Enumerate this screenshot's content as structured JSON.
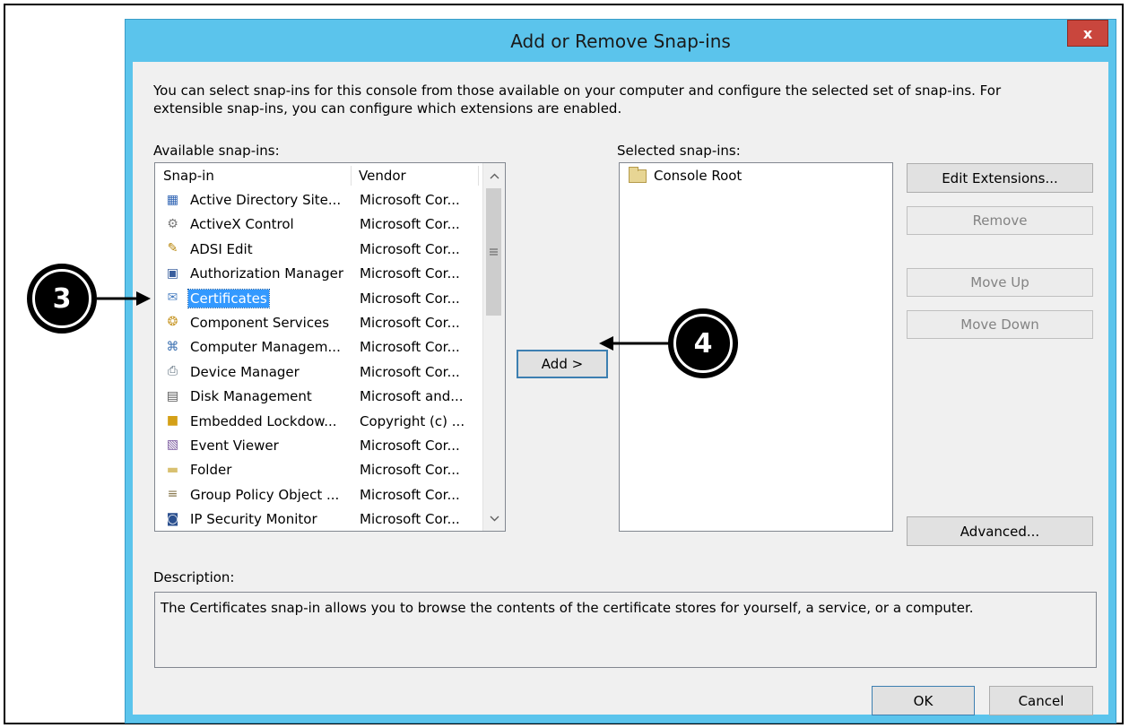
{
  "window": {
    "title": "Add or Remove Snap-ins",
    "close_label": "x"
  },
  "intro_text": "You can select snap-ins for this console from those available on your computer and configure the selected set of snap-ins. For extensible snap-ins, you can configure which extensions are enabled.",
  "available": {
    "label": "Available snap-ins:",
    "columns": [
      "Snap-in",
      "Vendor"
    ],
    "items": [
      {
        "name": "Active Directory Site...",
        "vendor": "Microsoft Cor...",
        "icon": "ad-sites-icon"
      },
      {
        "name": "ActiveX Control",
        "vendor": "Microsoft Cor...",
        "icon": "activex-icon"
      },
      {
        "name": "ADSI Edit",
        "vendor": "Microsoft Cor...",
        "icon": "adsi-edit-icon"
      },
      {
        "name": "Authorization Manager",
        "vendor": "Microsoft Cor...",
        "icon": "authorization-manager-icon"
      },
      {
        "name": "Certificates",
        "vendor": "Microsoft Cor...",
        "icon": "certificates-icon",
        "selected": true
      },
      {
        "name": "Component Services",
        "vendor": "Microsoft Cor...",
        "icon": "component-services-icon"
      },
      {
        "name": "Computer Managem...",
        "vendor": "Microsoft Cor...",
        "icon": "computer-management-icon"
      },
      {
        "name": "Device Manager",
        "vendor": "Microsoft Cor...",
        "icon": "device-manager-icon"
      },
      {
        "name": "Disk Management",
        "vendor": "Microsoft and...",
        "icon": "disk-management-icon"
      },
      {
        "name": "Embedded Lockdow...",
        "vendor": "Copyright (c) ...",
        "icon": "lock-icon"
      },
      {
        "name": "Event Viewer",
        "vendor": "Microsoft Cor...",
        "icon": "event-viewer-icon"
      },
      {
        "name": "Folder",
        "vendor": "Microsoft Cor...",
        "icon": "folder-icon"
      },
      {
        "name": "Group Policy Object ...",
        "vendor": "Microsoft Cor...",
        "icon": "group-policy-icon"
      },
      {
        "name": "IP Security Monitor",
        "vendor": "Microsoft Cor...",
        "icon": "ip-security-icon"
      }
    ]
  },
  "add_button": "Add >",
  "selected": {
    "label": "Selected snap-ins:",
    "items": [
      {
        "name": "Console Root",
        "icon": "folder-icon"
      }
    ]
  },
  "side_buttons": {
    "edit_extensions": "Edit Extensions...",
    "remove": "Remove",
    "move_up": "Move Up",
    "move_down": "Move Down",
    "advanced": "Advanced..."
  },
  "description": {
    "label": "Description:",
    "text": "The Certificates snap-in allows you to browse the contents of the certificate stores for yourself, a service, or a computer."
  },
  "footer": {
    "ok": "OK",
    "cancel": "Cancel"
  },
  "callouts": {
    "step3": "3",
    "step4": "4"
  },
  "colors": {
    "title_bar": "#5bc4ec",
    "selection": "#3399ff",
    "close_button": "#c9463d"
  }
}
